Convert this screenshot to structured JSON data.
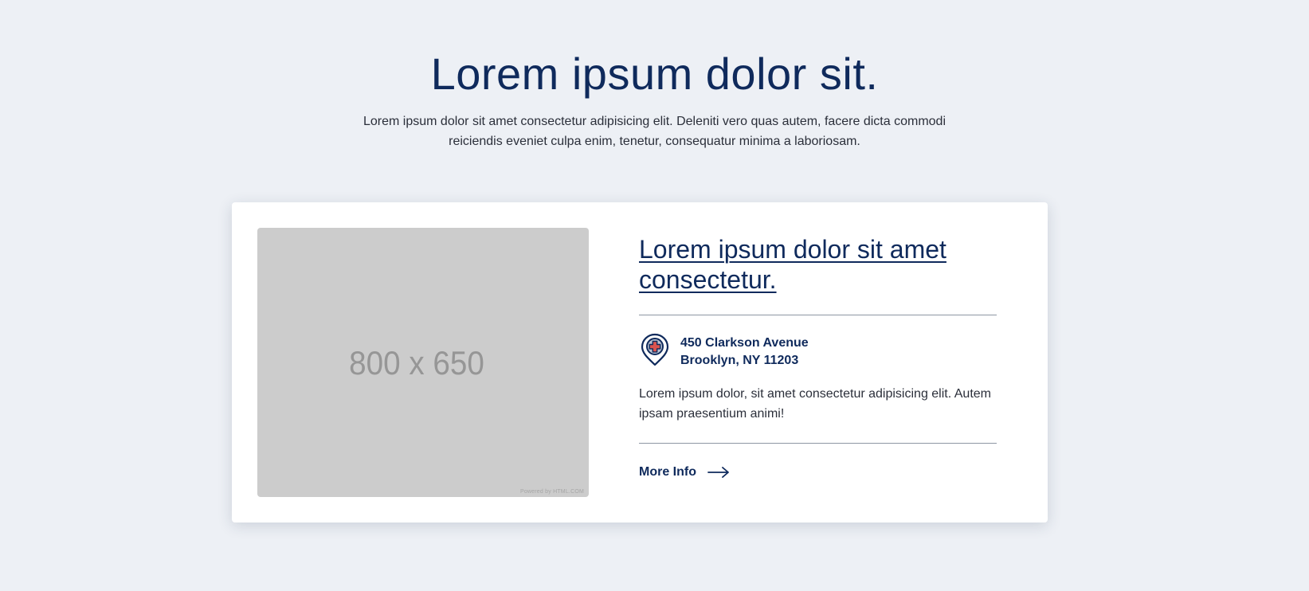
{
  "hero": {
    "title": "Lorem ipsum dolor sit.",
    "subtitle": "Lorem ipsum dolor sit amet consectetur adipisicing elit. Deleniti vero quas autem, facere dicta commodi reiciendis eveniet culpa enim, tenetur, consequatur minima a laboriosam."
  },
  "card": {
    "image": {
      "label": "800 x 650",
      "credit": "Powered by HTML.COM",
      "icon": "image-placeholder"
    },
    "title": "Lorem ipsum dolor sit amet consectetur.",
    "address": {
      "icon": "location-pin-medical-icon",
      "line1": "450 Clarkson Avenue",
      "line2": "Brooklyn, NY 11203"
    },
    "description": "Lorem ipsum dolor, sit amet consectetur adipisicing elit. Autem ipsam praesentium animi!",
    "more_info": {
      "label": "More Info",
      "icon": "arrow-right-icon"
    }
  },
  "colors": {
    "background": "#edf0f5",
    "navy": "#0f2a5c",
    "pin_cross": "#d9534f",
    "placeholder": "#cccccc"
  }
}
